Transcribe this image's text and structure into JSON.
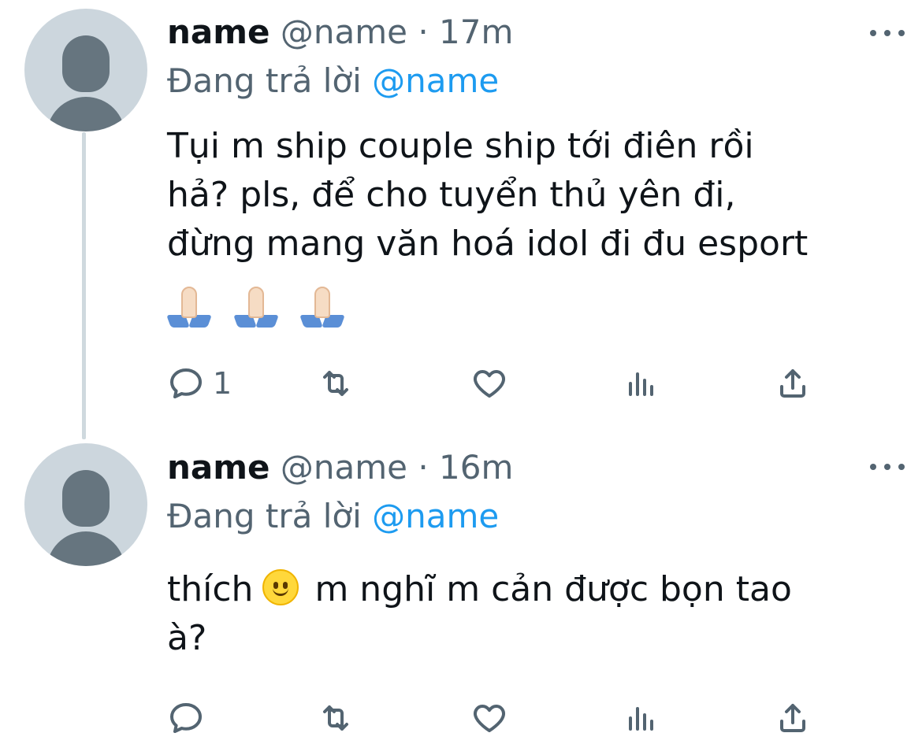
{
  "tweets": [
    {
      "author": "name",
      "handle": "@name",
      "separator": "·",
      "time": "17m",
      "reply_prefix": "Đang trả lời",
      "reply_mention": "@name",
      "text_lines": [
        "Tụi m ship couple ship tới điên rồi",
        "hả? pls, để cho tuyển thủ yên đi,",
        "đừng mang văn hoá idol đi đu esport"
      ],
      "emojis": [
        "folded-hands",
        "folded-hands",
        "folded-hands"
      ],
      "reply_count": "1"
    },
    {
      "author": "name",
      "handle": "@name",
      "separator": "·",
      "time": "16m",
      "reply_prefix": "Đang trả lời",
      "reply_mention": "@name",
      "text_before_emoji": "thích",
      "inline_emoji": "slightly-smiling-face",
      "text_after_emoji": "m nghĩ m cản được bọn tao",
      "text_line_2": "à?",
      "reply_count": ""
    }
  ],
  "icons": {
    "reply": "reply-icon",
    "retweet": "retweet-icon",
    "like": "heart-icon",
    "stats": "stats-icon",
    "share": "share-icon",
    "more": "more-icon"
  },
  "colors": {
    "text": "#0f1419",
    "muted": "#536471",
    "link": "#1d9bf0",
    "avatar_bg": "#ccd6dd",
    "thread_line": "#cfd9de"
  }
}
